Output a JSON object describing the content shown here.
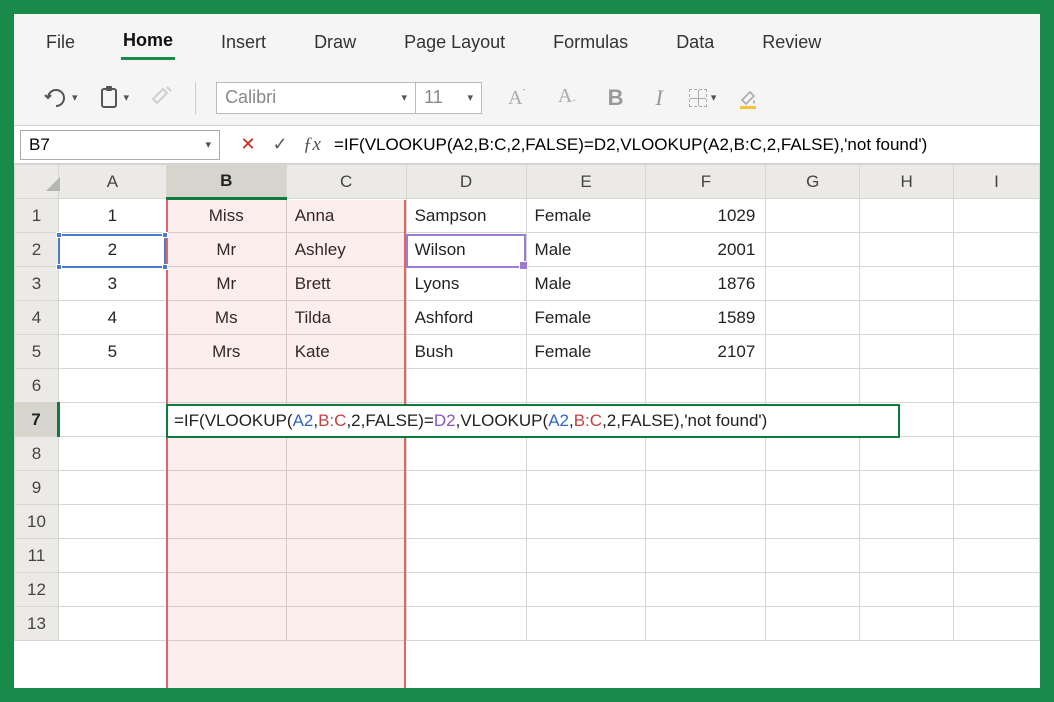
{
  "ribbon": {
    "tabs": [
      "File",
      "Home",
      "Insert",
      "Draw",
      "Page Layout",
      "Formulas",
      "Data",
      "Review"
    ],
    "active_tab": "Home"
  },
  "toolbar": {
    "font_name": "Calibri",
    "font_size": "11"
  },
  "formula_bar": {
    "name_box": "B7",
    "formula": "=IF(VLOOKUP(A2,B:C,2,FALSE)=D2,VLOOKUP(A2,B:C,2,FALSE),'not found')"
  },
  "columns": [
    "A",
    "B",
    "C",
    "D",
    "E",
    "F",
    "G",
    "H",
    "I"
  ],
  "row_headers": [
    "1",
    "2",
    "3",
    "4",
    "5",
    "6",
    "7",
    "8",
    "9",
    "10",
    "11",
    "12",
    "13"
  ],
  "active_col": "B",
  "active_row": "7",
  "table": {
    "rows": [
      {
        "A": "1",
        "B": "Miss",
        "C": "Anna",
        "D": "Sampson",
        "E": "Female",
        "F": "1029"
      },
      {
        "A": "2",
        "B": "Mr",
        "C": "Ashley",
        "D": "Wilson",
        "E": "Male",
        "F": "2001"
      },
      {
        "A": "3",
        "B": "Mr",
        "C": "Brett",
        "D": "Lyons",
        "E": "Male",
        "F": "1876"
      },
      {
        "A": "4",
        "B": "Ms",
        "C": "Tilda",
        "D": "Ashford",
        "E": "Female",
        "F": "1589"
      },
      {
        "A": "5",
        "B": "Mrs",
        "C": "Kate",
        "D": "Bush",
        "E": "Female",
        "F": "2107"
      }
    ]
  },
  "cell_edit": {
    "parts": [
      {
        "t": "=IF(VLOOKUP(",
        "c": "tok-fn"
      },
      {
        "t": "A2",
        "c": "tok-a2"
      },
      {
        "t": ",",
        "c": "tok-fn"
      },
      {
        "t": "B:C",
        "c": "tok-bc"
      },
      {
        "t": ",2,FALSE)=",
        "c": "tok-fn"
      },
      {
        "t": "D2",
        "c": "tok-d2"
      },
      {
        "t": ",VLOOKUP(",
        "c": "tok-fn"
      },
      {
        "t": "A2",
        "c": "tok-a2"
      },
      {
        "t": ",",
        "c": "tok-fn"
      },
      {
        "t": "B:C",
        "c": "tok-bc"
      },
      {
        "t": ",2,FALSE),'not found')",
        "c": "tok-fn"
      }
    ]
  }
}
